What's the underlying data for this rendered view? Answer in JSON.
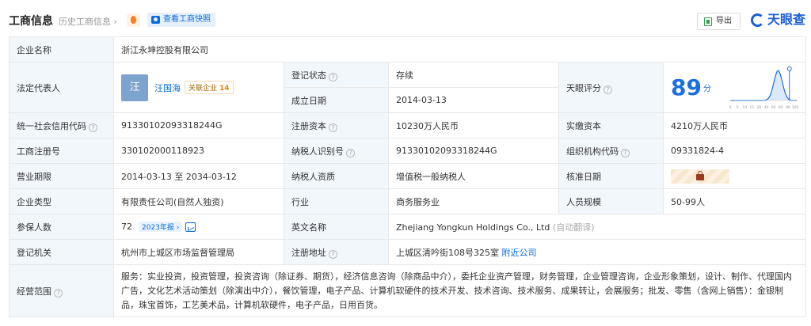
{
  "header": {
    "title": "工商信息",
    "history_link": "历史工商信息",
    "snapshot_button": "查看工商快照",
    "export_button": "导出",
    "brand": "天眼查"
  },
  "company": {
    "name_label": "企业名称",
    "name": "浙江永坤控股有限公司",
    "legal_rep_label": "法定代表人",
    "legal_rep_avatar": "汪",
    "legal_rep": "汪国海",
    "related_label": "关联企业",
    "related_count": "14",
    "reg_status_label": "登记状态",
    "reg_status": "存续",
    "established_label": "成立日期",
    "established": "2014-03-13",
    "score_label": "天眼评分",
    "score": "89",
    "score_unit": "分",
    "credit_code_label": "统一社会信用代码",
    "credit_code": "91330102093318244G",
    "reg_capital_label": "注册资本",
    "reg_capital": "10230万人民币",
    "paid_capital_label": "实缴资本",
    "paid_capital": "4210万人民币",
    "reg_no_label": "工商注册号",
    "reg_no": "330102000118923",
    "taxpayer_id_label": "纳税人识别号",
    "taxpayer_id": "91330102093318244G",
    "org_code_label": "组织机构代码",
    "org_code": "09331824-4",
    "term_label": "营业期限",
    "term": "2014-03-13 至 2034-03-12",
    "taxpayer_qual_label": "纳税人资质",
    "taxpayer_qual": "增值税一般纳税人",
    "approved_date_label": "核准日期",
    "type_label": "企业类型",
    "type": "有限责任公司(自然人独资)",
    "industry_label": "行业",
    "industry": "商务服务业",
    "staff_label": "人员规模",
    "staff": "50-99人",
    "insured_label": "参保人数",
    "insured": "72",
    "insured_year": "2023年报",
    "english_name_label": "英文名称",
    "english_name": "Zhejiang Yongkun Holdings Co., Ltd",
    "english_note": "(自动翻译)",
    "authority_label": "登记机关",
    "authority": "杭州市上城区市场监督管理局",
    "address_label": "注册地址",
    "address": "上城区清吟街108号325室",
    "nearby_link": "附近公司",
    "scope_label": "经营范围",
    "scope": "服务：实业投资，投资管理，投资咨询（除证券、期货），经济信息咨询（除商品中介），委托企业资产管理，财务管理，企业管理咨询，企业形象策划，设计、制作、代理国内广告，文化艺术活动策划（除演出中介），餐饮管理，电子产品、计算机软硬件的技术开发、技术咨询、技术服务、成果转让，会展服务；批发、零售（含网上销售）：金银制品，珠宝首饰，工艺美术品，计算机软硬件，电子产品，日用百货。"
  },
  "score_chart": {
    "x_ticks": [
      "0",
      "5",
      "10",
      "15",
      "20",
      "40",
      "60",
      "80",
      "90",
      "100"
    ],
    "colors": {
      "curve": "#1b6fe0",
      "fill": "#dbe9fb",
      "marker": "#1b6fe0"
    }
  }
}
